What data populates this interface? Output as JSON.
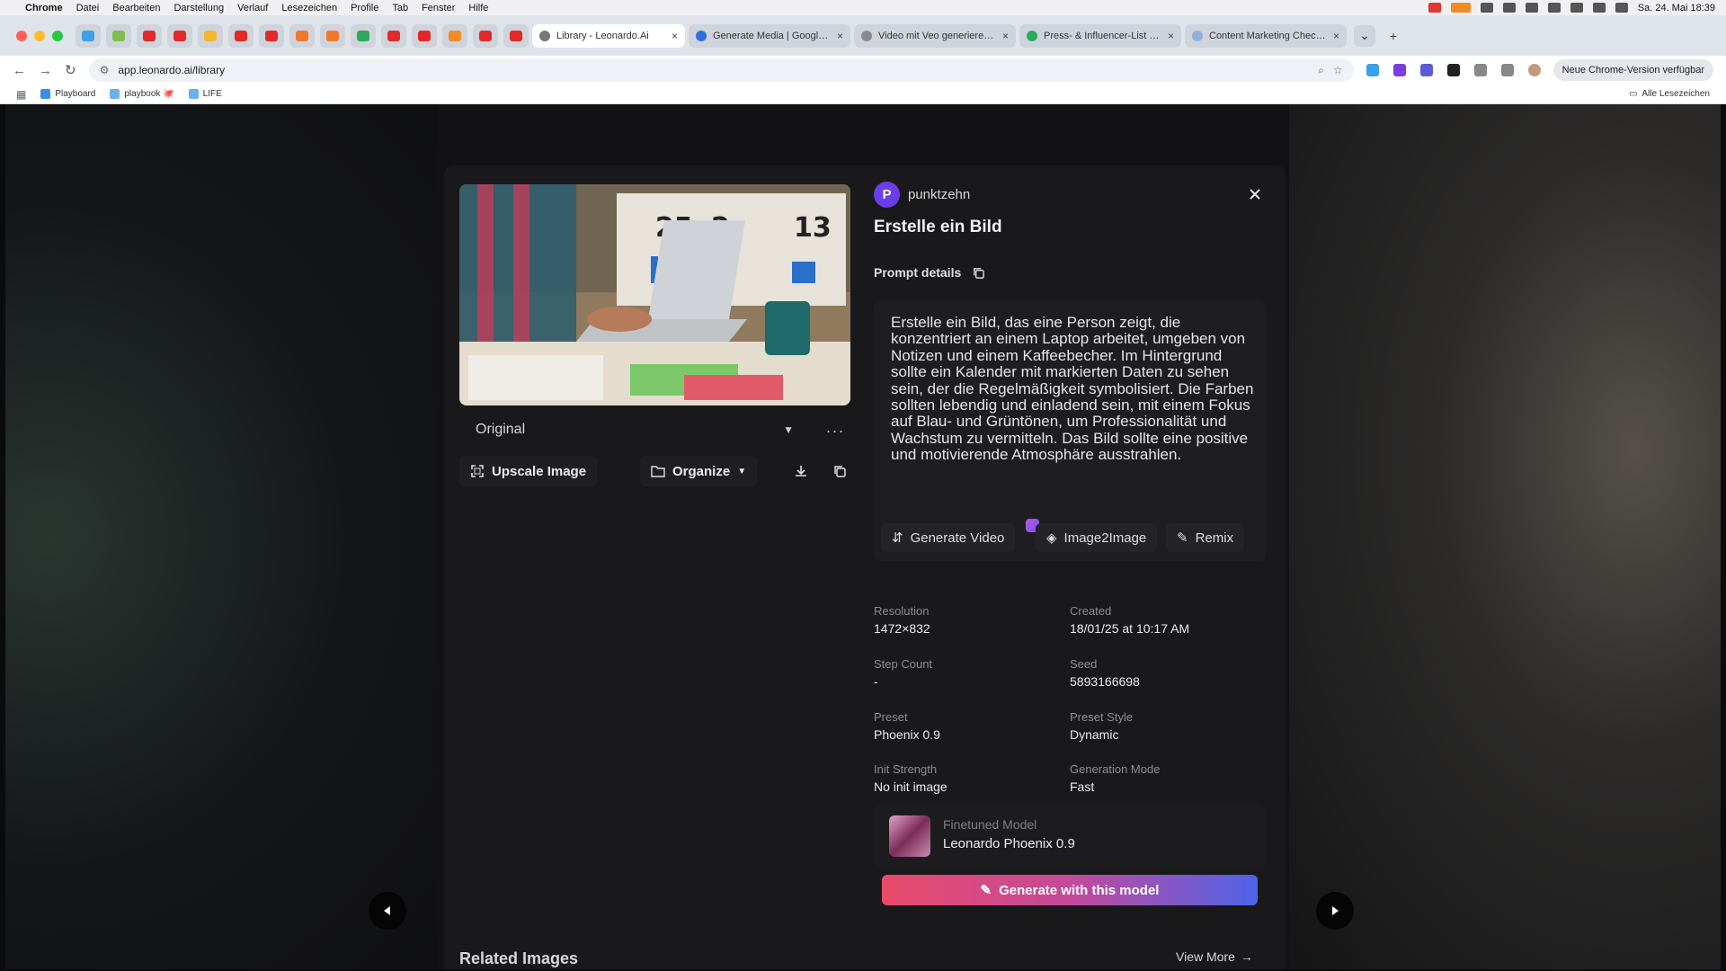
{
  "menubar": {
    "app": "Chrome",
    "items": [
      "Datei",
      "Bearbeiten",
      "Darstellung",
      "Verlauf",
      "Lesezeichen",
      "Profile",
      "Tab",
      "Fenster",
      "Hilfe"
    ],
    "clock": "Sa. 24. Mai 18:39"
  },
  "browser": {
    "tabs": [
      {
        "title": "Library - Leonardo.Ai",
        "active": true
      },
      {
        "title": "Generate Media | Google AI S",
        "active": false
      },
      {
        "title": "Video mit Veo generieren | G",
        "active": false
      },
      {
        "title": "Press- & Influencer-List - Go",
        "active": false
      },
      {
        "title": "Content Marketing Checkliste",
        "active": false
      }
    ],
    "url": "app.leonardo.ai/library",
    "update_label": "Neue Chrome-Version verfügbar",
    "bookmarks": [
      "Playboard",
      "playbook 🐙",
      "LIFE"
    ],
    "all_bookmarks": "Alle Lesezeichen"
  },
  "modal": {
    "owner": "punktzehn",
    "owner_initial": "P",
    "title": "Erstelle ein Bild",
    "prompt_details_label": "Prompt details",
    "prompt": "Erstelle ein Bild, das eine Person zeigt, die konzentriert an einem Laptop arbeitet, umgeben von Notizen und einem Kaffeebecher. Im Hintergrund sollte ein Kalender mit markierten Daten zu sehen sein, der die Regelmäßigkeit symbolisiert. Die Farben sollten lebendig und einladend sein, mit einem Fokus auf Blau- und Grüntönen, um Professionalität und Wachstum zu vermitteln. Das Bild sollte eine positive und motivierende Atmosphäre ausstrahlen.",
    "image_calendar": [
      "25",
      "2",
      "13"
    ],
    "variant": "Original",
    "upscale_label": "Upscale Image",
    "organize_label": "Organize",
    "actions": {
      "generate_video": "Generate Video",
      "image2image": "Image2Image",
      "remix": "Remix"
    },
    "meta": [
      {
        "label": "Resolution",
        "value": "1472×832"
      },
      {
        "label": "Created",
        "value": "18/01/25 at 10:17 AM"
      },
      {
        "label": "Step Count",
        "value": "-"
      },
      {
        "label": "Seed",
        "value": "5893166698"
      },
      {
        "label": "Preset",
        "value": "Phoenix 0.9"
      },
      {
        "label": "Preset Style",
        "value": "Dynamic"
      },
      {
        "label": "Init Strength",
        "value": "No init image"
      },
      {
        "label": "Generation Mode",
        "value": "Fast"
      }
    ],
    "model": {
      "sub": "Finetuned Model",
      "name": "Leonardo Phoenix 0.9"
    },
    "generate_with_model": "Generate with this model",
    "related_images": "Related Images",
    "view_more": "View More"
  }
}
